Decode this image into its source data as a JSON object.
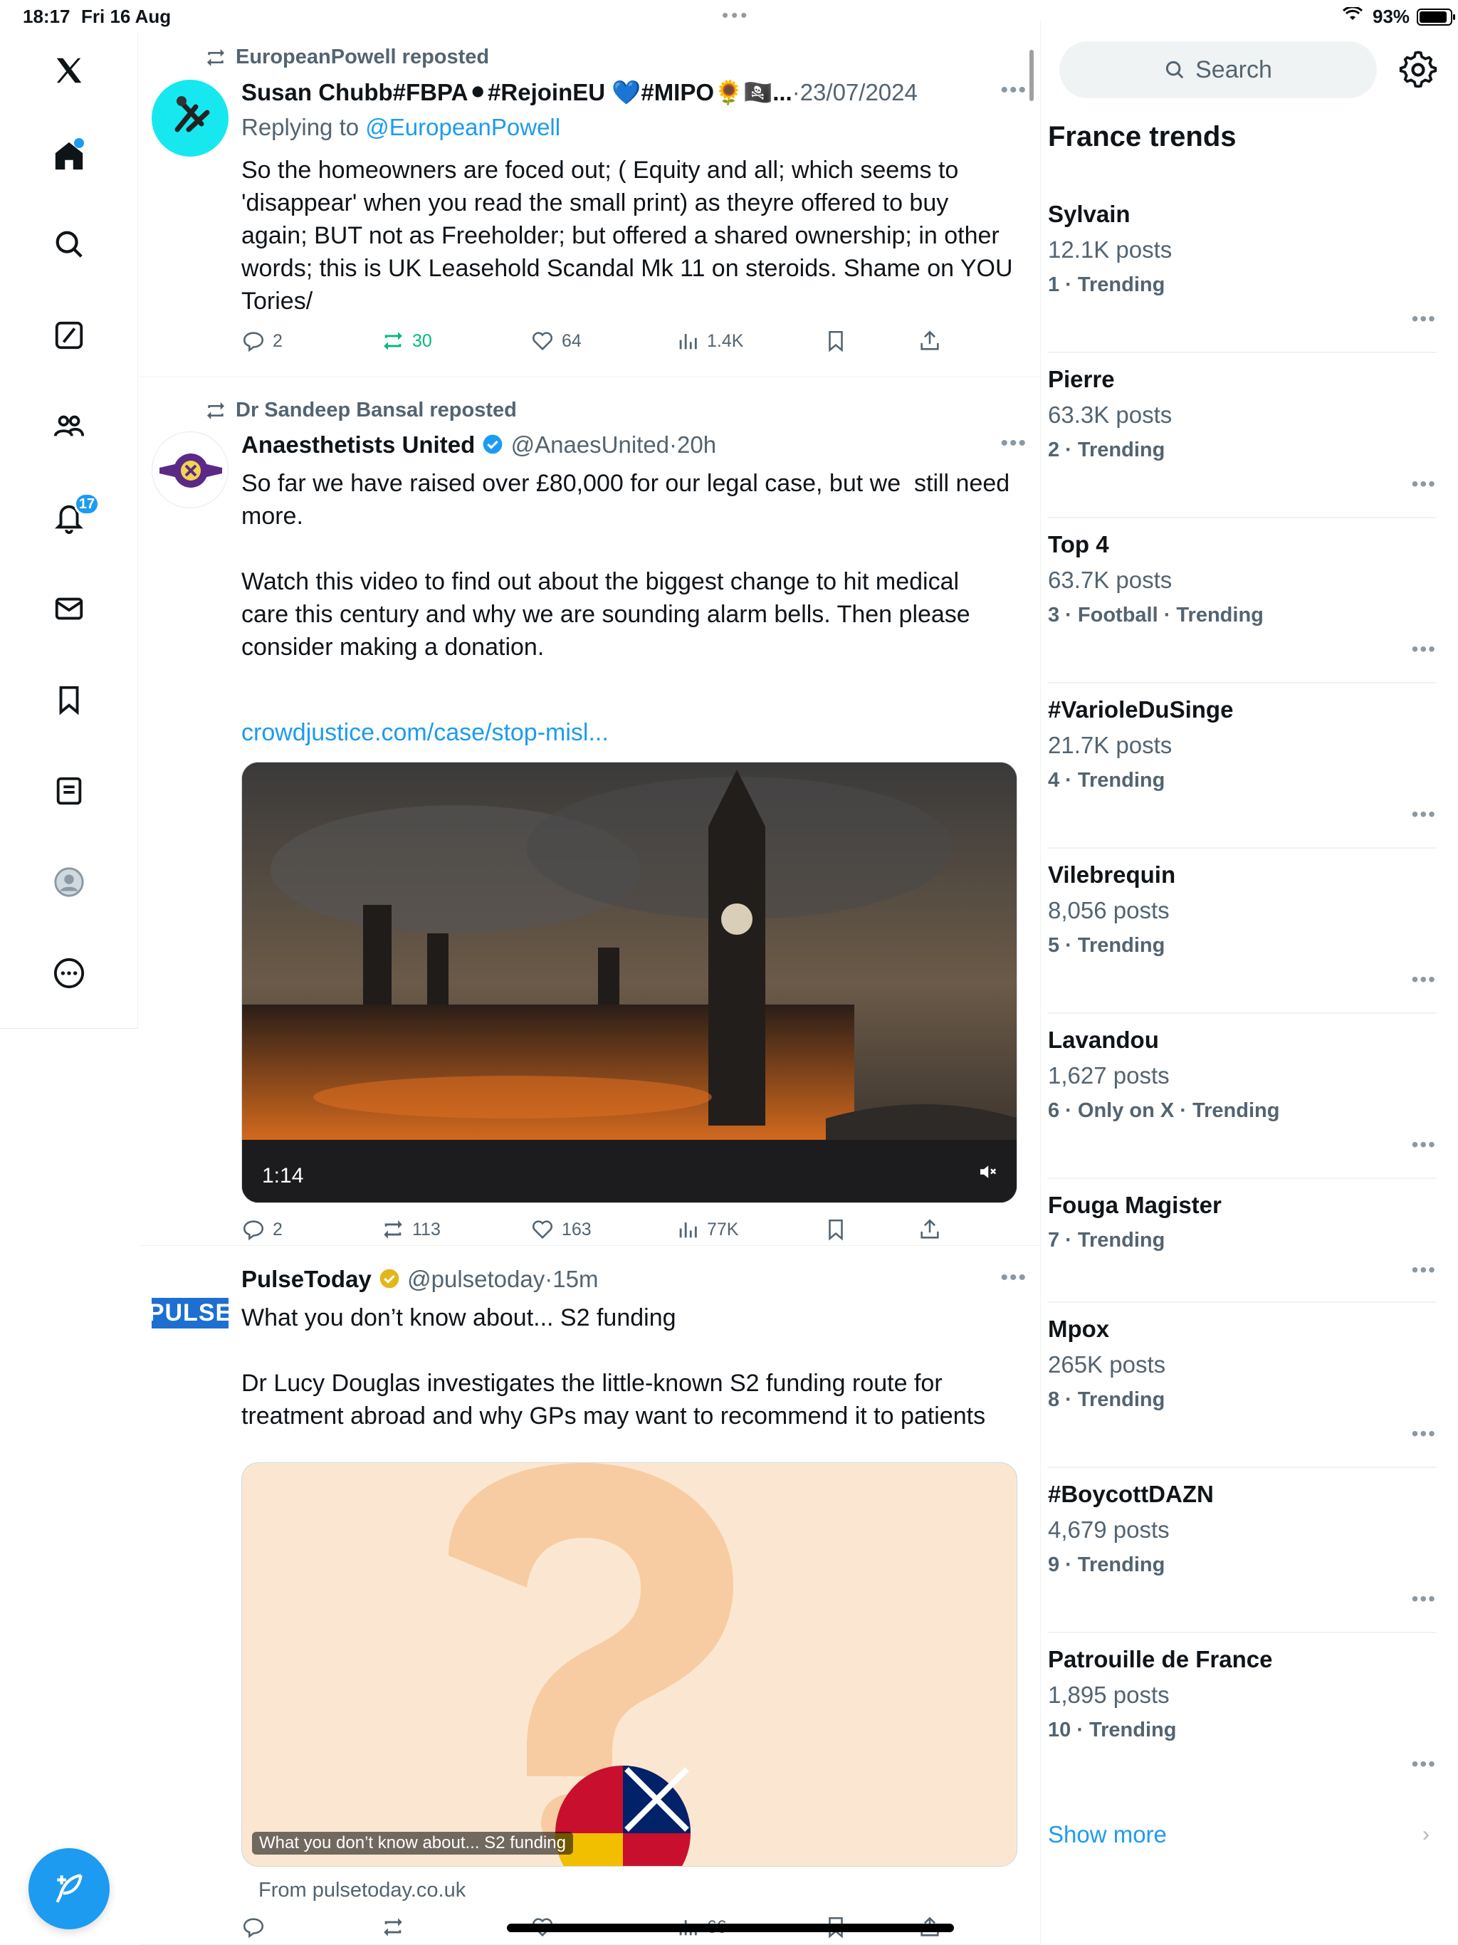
{
  "status_bar": {
    "time": "18:17",
    "date": "Fri 16 Aug",
    "battery": "93%"
  },
  "nav": {
    "notifications_badge": "17"
  },
  "tweets": [
    {
      "repost_by": "EuropeanPowell reposted",
      "name": "Susan Chubb#FBPA⚫#RejoinEU 💙#MIPO🌻🏴‍☠️...",
      "meta": "·23/07/2024",
      "replying_prefix": "Replying to ",
      "replying_to": "@EuropeanPowell",
      "text": "So the homeowners are foced out; ( Equity and all; which seems to\n'disappear' when you read the small print) as theyre offered to buy\nagain; BUT not as Freeholder; but offered a shared ownership; in other\nwords; this is UK Leasehold Scandal Mk 11 on steroids. Shame on YOU\nTories/",
      "replies": "2",
      "reposts": "30",
      "likes": "64",
      "views": "1.4K"
    },
    {
      "repost_by": "Dr Sandeep Bansal reposted",
      "name": "Anaesthetists United",
      "handle": "@AnaesUnited",
      "meta": "·20h",
      "text": "So far we have raised over £80,000 for our legal case, but we  still need\nmore.\n\nWatch this video to find out about the biggest change to hit medical\ncare this century and why we are sounding alarm bells. Then please\nconsider making a donation.",
      "link": "crowdjustice.com/case/stop-misl...",
      "video_time": "1:14",
      "replies": "2",
      "reposts": "113",
      "likes": "163",
      "views": "77K"
    },
    {
      "name": "PulseToday",
      "handle": "@pulsetoday",
      "meta": "·15m",
      "avatar_text": "PULSE",
      "text": "What you don’t know about... S2 funding\n\nDr Lucy Douglas investigates the little-known S2 funding route for\ntreatment abroad and why GPs may want to recommend it to patients",
      "card_caption": "What you don’t know about... S2 funding",
      "card_source": "From pulsetoday.co.uk",
      "views": "66"
    }
  ],
  "sidebar": {
    "search_placeholder": "Search",
    "trends_title": "France trends",
    "trends": [
      {
        "name": "Sylvain",
        "posts": "12.1K posts",
        "rank": "1 · Trending"
      },
      {
        "name": "Pierre",
        "posts": "63.3K posts",
        "rank": "2 · Trending"
      },
      {
        "name": "Top 4",
        "posts": "63.7K posts",
        "rank": "3 · Football · Trending"
      },
      {
        "name": "#VarioleDuSinge",
        "posts": "21.7K posts",
        "rank": "4 · Trending"
      },
      {
        "name": "Vilebrequin",
        "posts": "8,056 posts",
        "rank": "5 · Trending"
      },
      {
        "name": "Lavandou",
        "posts": "1,627 posts",
        "rank": "6 · Only on X · Trending"
      },
      {
        "name": "Fouga Magister",
        "posts": "",
        "rank": "7 · Trending"
      },
      {
        "name": "Mpox",
        "posts": "265K posts",
        "rank": "8 · Trending"
      },
      {
        "name": "#BoycottDAZN",
        "posts": "4,679 posts",
        "rank": "9 · Trending"
      },
      {
        "name": "Patrouille de France",
        "posts": "1,895 posts",
        "rank": "10 · Trending"
      }
    ],
    "show_more": "Show more"
  },
  "colors": {
    "accent": "#1d9bf0",
    "repost_green": "#00ba7c",
    "muted": "#536471",
    "verified_gold": "#e2b719"
  }
}
